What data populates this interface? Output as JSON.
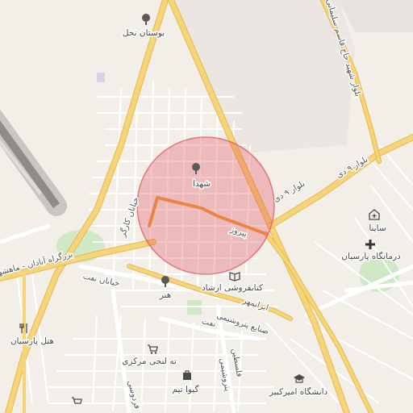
{
  "map": {
    "kind": "street-map",
    "accent_circle_color": "#e24b5a",
    "main_road_color": "#f6cf6a",
    "pois": [
      {
        "id": "park-nakhl",
        "label": "بوستان نخل",
        "icon": "tree-icon"
      },
      {
        "id": "park-shohada",
        "label": "شهدا",
        "icon": "tree-icon"
      },
      {
        "id": "park-honar",
        "label": "هنر",
        "icon": "tree-icon"
      },
      {
        "id": "bookstore-ershad",
        "label": "کتابفروشی ارشاد",
        "icon": "book-icon"
      },
      {
        "id": "saina",
        "label": "ساینا",
        "icon": "clinic-icon"
      },
      {
        "id": "clinic-parsian",
        "label": "درمانگاه پارسیان",
        "icon": "cross-icon"
      },
      {
        "id": "hotel-parsian",
        "label": "هتل پارسیان",
        "icon": "restaurant-icon"
      },
      {
        "id": "tehlanchi",
        "label": "ته لنجی مرکزی",
        "icon": "shopping-cart-icon"
      },
      {
        "id": "geo-team",
        "label": "گیوا تیم",
        "icon": "shopping-bag-icon"
      },
      {
        "id": "amirkabir",
        "label": "دانشگاه امیرکبیر",
        "icon": "university-icon"
      }
    ],
    "road_labels": [
      {
        "id": "blvd-qasem",
        "text": "بلوار شهید حاج قاسم سلیمانی"
      },
      {
        "id": "blvd-9dey-a",
        "text": "بلوار ۹ دی"
      },
      {
        "id": "blvd-9dey-b",
        "text": "بلوار ۹ دی"
      },
      {
        "id": "street-karegar",
        "text": "خیابان کارگر"
      },
      {
        "id": "highway-abadan",
        "text": "بزرگراه آبادان - ماهشهر"
      },
      {
        "id": "street-naft",
        "text": "خیابان نفت"
      },
      {
        "id": "street-naft-2",
        "text": "نفت"
      },
      {
        "id": "sanaye",
        "text": "صنایع پتروشیمی"
      },
      {
        "id": "pirouz",
        "text": "پیروز"
      },
      {
        "id": "falestin",
        "text": "فلسطین"
      },
      {
        "id": "petro-north",
        "text": "پتروشیمی"
      },
      {
        "id": "sanaye-pars",
        "text": "ایرانمهر"
      },
      {
        "id": "bottom-street",
        "text": "فردوسی"
      }
    ]
  }
}
